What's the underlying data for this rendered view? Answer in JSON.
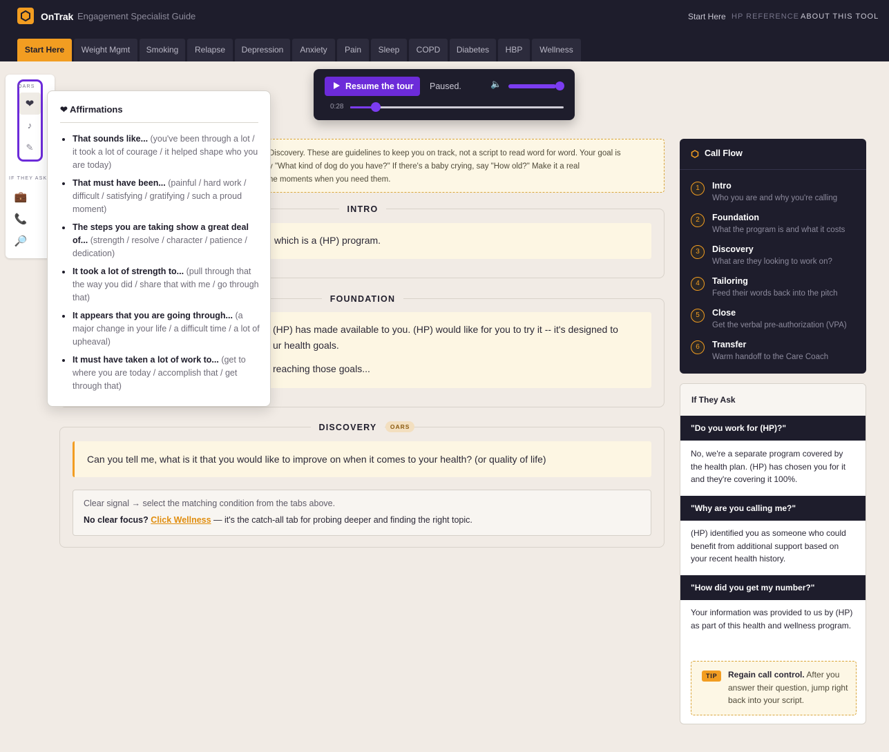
{
  "header": {
    "brand": "OnTrak",
    "subtitle": "Engagement Specialist Guide",
    "links": [
      "Start Here",
      "HP REFERENCE",
      "ABOUT THIS TOOL"
    ]
  },
  "tabs": [
    "Start Here",
    "Weight Mgmt",
    "Smoking",
    "Relapse",
    "Depression",
    "Anxiety",
    "Pain",
    "Sleep",
    "COPD",
    "Diabetes",
    "HBP",
    "Wellness"
  ],
  "active_tab": "Start Here",
  "rail": {
    "oars_label": "OARS",
    "if_they_ask_label": "IF THEY ASK",
    "oars_icons": [
      "heart-icon",
      "music-note-icon",
      "pencil-icon"
    ],
    "ask_icons": [
      "briefcase-icon",
      "phone-icon",
      "magnifier-icon"
    ]
  },
  "popover": {
    "title": "❤ Affirmations",
    "items": [
      {
        "lead": "That sounds like...",
        "rest": " (you've been through a lot / it took a lot of courage / it helped shape who you are today)"
      },
      {
        "lead": "That must have been...",
        "rest": " (painful / hard work / difficult / satisfying / gratifying / such a proud moment)"
      },
      {
        "lead": "The steps you are taking show a great deal of...",
        "rest": " (strength / resolve / character / patience / dedication)"
      },
      {
        "lead": "It took a lot of strength to...",
        "rest": " (pull through that the way you did / share that with me / go through that)"
      },
      {
        "lead": "It appears that you are going through...",
        "rest": " (a major change in your life / a difficult time / a lot of upheaval)"
      },
      {
        "lead": "It must have taken a lot of work to...",
        "rest": " (get to where you are today / accomplish that / get through that)"
      }
    ]
  },
  "player": {
    "resume_label": "Resume the tour",
    "status": "Paused.",
    "time": "0:28",
    "volume_fraction": 0.95,
    "progress_fraction": 0.12
  },
  "note": {
    "lines": [
      "Discovery. These are guidelines to keep you on track, not a script to read word for word. Your goal is",
      "y \"What kind of dog do you have?\" If there's a baby crying, say \"How old?\" Make it a real",
      "he moments when you need them."
    ]
  },
  "sections": {
    "intro": {
      "title": "INTRO",
      "script": "which is a (HP) program."
    },
    "foundation": {
      "title": "FOUNDATION",
      "script_line1": "(HP) has made available to you. (HP) would like for you to try it -- it's designed to",
      "script_line2": "ur health goals.",
      "script_line3": "reaching those goals..."
    },
    "discovery": {
      "title": "DISCOVERY",
      "badge": "OARS",
      "script": "Can you tell me, what is it that you would like to improve on when it comes to your health? (or quality of life)",
      "signal_line1": "Clear signal → select the matching condition from the tabs above.",
      "signal_bold": "No clear focus?",
      "signal_link": "Click Wellness",
      "signal_rest": " — it's the catch-all tab for probing deeper and finding the right topic."
    }
  },
  "call_flow": {
    "title": "Call Flow",
    "steps": [
      {
        "num": "1",
        "title": "Intro",
        "desc": "Who you are and why you're calling"
      },
      {
        "num": "2",
        "title": "Foundation",
        "desc": "What the program is and what it costs"
      },
      {
        "num": "3",
        "title": "Discovery",
        "desc": "What are they looking to work on?"
      },
      {
        "num": "4",
        "title": "Tailoring",
        "desc": "Feed their words back into the pitch"
      },
      {
        "num": "5",
        "title": "Close",
        "desc": "Get the verbal pre-authorization (VPA)"
      },
      {
        "num": "6",
        "title": "Transfer",
        "desc": "Warm handoff to the Care Coach"
      }
    ]
  },
  "if_they_ask": {
    "title": "If They Ask",
    "qa": [
      {
        "q": "\"Do you work for (HP)?\"",
        "a": "No, we're a separate program covered by the health plan. (HP) has chosen you for it and they're covering it 100%."
      },
      {
        "q": "\"Why are you calling me?\"",
        "a": "(HP) identified you as someone who could benefit from additional support based on your recent health history."
      },
      {
        "q": "\"How did you get my number?\"",
        "a": "Your information was provided to us by (HP) as part of this health and wellness program."
      }
    ],
    "tip_badge": "TIP",
    "tip_bold": "Regain call control.",
    "tip_rest": " After you answer their question, jump right back into your script."
  },
  "colors": {
    "accent": "#f29d21",
    "primary": "#6c2bd9",
    "dark": "#1e1d2c",
    "background": "#f1ebe5"
  }
}
